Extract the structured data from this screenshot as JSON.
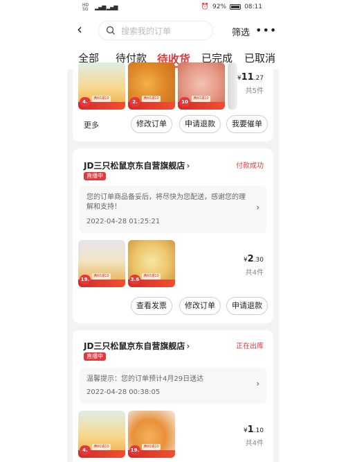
{
  "status_bar": {
    "left_indicators": "HD\n5G",
    "signal": "⁴⁶ıll ıll",
    "alarm": "⏰",
    "battery": "92%",
    "time": "08:11"
  },
  "header": {
    "back": "‹",
    "search_placeholder": "搜索我的订单",
    "filter": "筛选",
    "more": "•••"
  },
  "tabs": [
    {
      "label": "全部",
      "active": false
    },
    {
      "label": "待付款",
      "active": false
    },
    {
      "label": "待收货",
      "active": true
    },
    {
      "label": "已完成",
      "active": false
    },
    {
      "label": "已取消",
      "active": false
    }
  ],
  "orders": [
    {
      "price_symbol": "¥",
      "price_int": "11",
      "price_dec": ".27",
      "count": "共5件",
      "more": "更多",
      "thumbs": [
        {
          "badge": "4.",
          "tag": "满60减10"
        },
        {
          "badge": "2.",
          "tag": "满60减10"
        },
        {
          "badge": "10",
          "tag": "满60减10"
        }
      ],
      "buttons": [
        "修改订单",
        "申请退款",
        "我要催单"
      ]
    },
    {
      "store": "JD三只松鼠京东自营旗舰店",
      "live": "直播中",
      "state": "付款成功",
      "notice": "您的订单商品备妥后，将尽快为您配送，感谢您的理解和支持！",
      "time": "2022-04-28 01:25:21",
      "price_symbol": "¥",
      "price_int": "2",
      "price_dec": ".30",
      "count": "共4件",
      "thumbs": [
        {
          "badge": "19.",
          "tag": "满60减10"
        },
        {
          "badge": "3.6",
          "tag": "满60减10"
        }
      ],
      "buttons": [
        "查看发票",
        "修改订单",
        "申请退款"
      ]
    },
    {
      "store": "JD三只松鼠京东自营旗舰店",
      "live": "直播中",
      "state": "正在出库",
      "notice": "温馨提示：您的订单预计4月29日送达",
      "time": "2022-04-28 00:38:05",
      "price_symbol": "¥",
      "price_int": "1",
      "price_dec": ".10",
      "count": "共4件",
      "thumbs": [
        {
          "badge": "4.",
          "tag": "满60减10"
        },
        {
          "badge": "19.",
          "tag": "满60减10"
        }
      ]
    }
  ],
  "colors": {
    "accent": "#e4393c",
    "background": "#f3f3f3"
  }
}
